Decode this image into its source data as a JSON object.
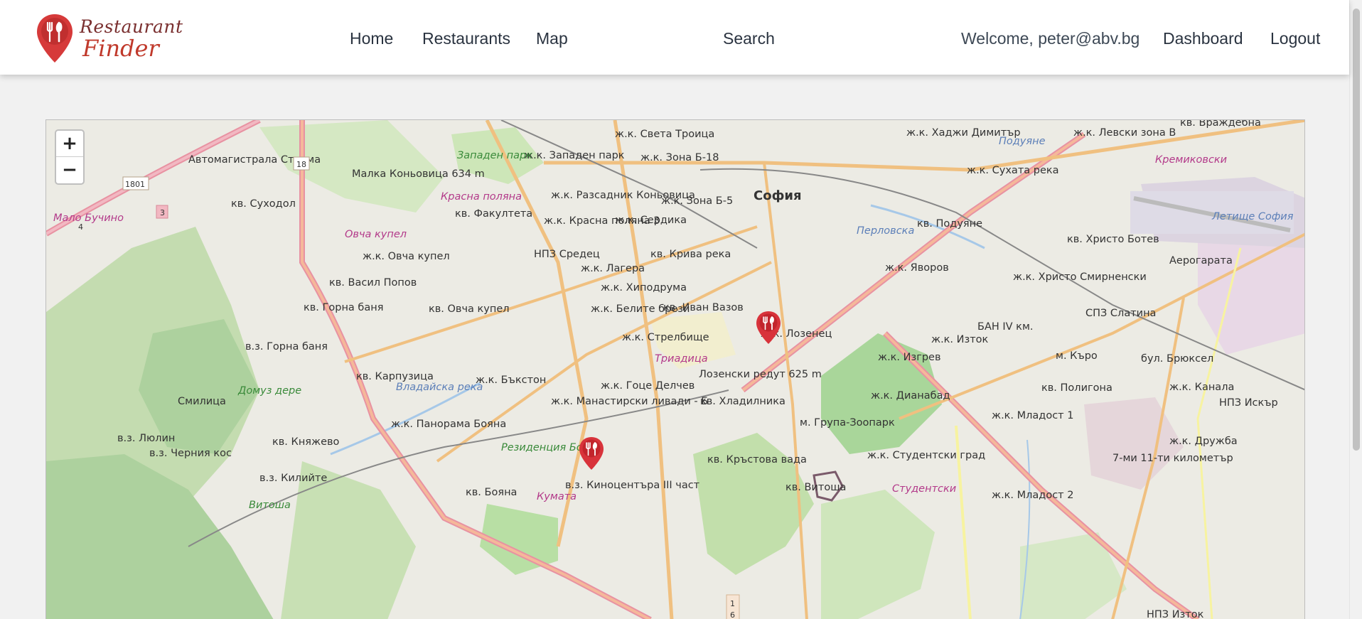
{
  "brand": {
    "line1": "Restaurant",
    "line2": "Finder"
  },
  "nav": {
    "home": "Home",
    "restaurants": "Restaurants",
    "map": "Map",
    "search": "Search",
    "welcome": "Welcome, peter@abv.bg",
    "dashboard": "Dashboard",
    "logout": "Logout"
  },
  "map": {
    "zoom_in": "+",
    "zoom_out": "−",
    "markers": [
      "restaurant-marker",
      "restaurant-marker"
    ],
    "labels": {
      "sofia": "София",
      "troitsa": "ж.к. Света Троица",
      "zona_b18": "ж.к. Зона Б-18",
      "zapaden_park": "ж.к. Западен парк",
      "zapaden_park_park": "Западен парк",
      "hadzhi": "ж.к. Хаджи Димитър",
      "levski": "ж.к. Левски зона В",
      "vrazhdebna": "кв. Враждебна",
      "podujane_river": "Подуяне",
      "suhata": "ж.к. Сухата река",
      "kremikovski": "Кремиковски",
      "razsadnik": "ж.к. Разсадник Коньовица",
      "zona_b5": "ж.к. Зона Б-5",
      "malka": "Малка Коньовица 634 m",
      "krasna_river": "Красна поляна",
      "suhodol": "кв. Суходол",
      "fakulteta": "кв. Факултета",
      "krasna": "ж.к. Красна поляна 3",
      "serdika": "ж.к. Сердика",
      "malo": "Мало Бучино",
      "podujane": "кв. Подуяне",
      "letishte": "Летище София",
      "hristo_botev": "кв. Христо Ботев",
      "aerogara": "Аерогарата",
      "ovcha_kupel_river": "Овча купел",
      "ovcha_kupel": "ж.к. Овча купел",
      "npz": "НПЗ Средец",
      "kriva": "кв. Крива река",
      "lagera": "ж.к. Лагера",
      "yavorov": "ж.к. Яворов",
      "hristo_smirn": "ж.к. Христо Смирненски",
      "vasil": "кв. Васил Попов",
      "hipodruma": "ж.к. Хиподрума",
      "gorna_banya": "кв. Горна баня",
      "ovcha_kupel2": "кв. Овча купел",
      "belite": "ж.к. Белите брези",
      "ivan_vazov": "кв. Иван Вазов",
      "spz": "СПЗ Слатина",
      "ban": "БАН IV км.",
      "strelbishte": "ж.к. Стрелбище",
      "lozenets": "ж.к. Лозенец",
      "iztok": "ж.к. Изток",
      "vz_gorna": "в.з. Горна баня",
      "triaditsa": "Триадица",
      "izgrev": "ж.к. Изгрев",
      "karo": "м. Къро",
      "karpuzitsa": "кв. Карпузица",
      "bakston": "ж.к. Бъкстон",
      "goce": "ж.к. Гоце Делчев",
      "lozenski": "Лозенски редут 625 m",
      "poligona": "кв. Полигона",
      "kanala": "ж.к. Канала",
      "domuz": "Домуз дере",
      "smilitsa": "Смилица",
      "manastirski": "ж.к. Манастирски ливади - Б",
      "hladilnika": "кв. Хладилника",
      "dianabad": "ж.к. Дианабад",
      "npz_iskar": "НПЗ Искър",
      "grupa": "м. Група-Зоопарк",
      "mladost1": "ж.к. Младост 1",
      "panorama": "ж.к. Панорама Бояна",
      "lyulin": "в.з. Люлин",
      "knyazhevo": "кв. Княжево",
      "residentsia": "Резиденция Бояна",
      "druzhba": "ж.к. Дружба",
      "cherniya": "в.з. Черния кос",
      "krastova": "кв. Кръстова вада",
      "studentski": "ж.к. Студентски град",
      "sedmi": "7-ми 11-ти километър",
      "kilite": "в.з. Килийте",
      "boyana": "кв. Бояна",
      "kinotsentar": "в.з. Киноцентъра III част",
      "vitosha": "кв. Витоша",
      "studentski_pink": "Студентски",
      "mladost2": "ж.к. Младост 2",
      "vitosha_river": "Витоша",
      "kumata": "Кумата",
      "npz_iztok": "НПЗ Изток",
      "road18": "18",
      "road1801": "1801",
      "road3": "3",
      "road1": "1",
      "road6": "6",
      "road4": "4",
      "vladayska": "Владайска река",
      "perlovska": "Перловска",
      "bul_brussels": "бул. Брюксел",
      "avtomagistrala": "Автомагистрала Струма"
    }
  }
}
